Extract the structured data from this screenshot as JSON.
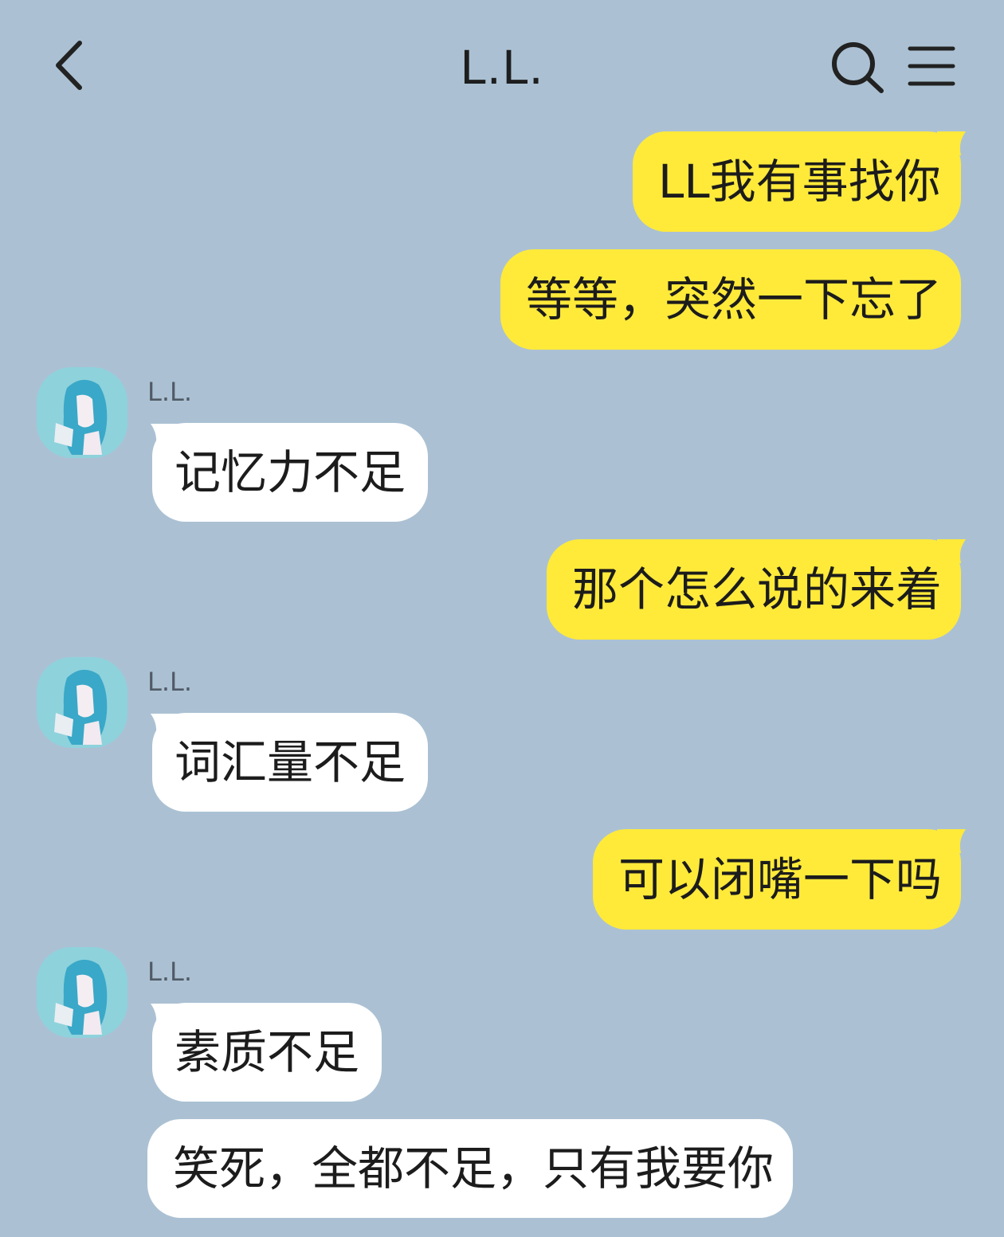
{
  "header": {
    "title": "L.L.",
    "back_icon": "chevron-left-icon",
    "search_icon": "search-icon",
    "menu_icon": "hamburger-menu-icon"
  },
  "colors": {
    "background": "#abc1d3",
    "my_bubble": "#ffea3a",
    "their_bubble": "#ffffff",
    "avatar_bg": "#8ed2dc"
  },
  "messages": [
    {
      "from": "me",
      "text": "LL我有事找你"
    },
    {
      "from": "me",
      "text": "等等，突然一下忘了"
    },
    {
      "from": "them",
      "sender": "L.L.",
      "text": "记忆力不足"
    },
    {
      "from": "me",
      "text": "那个怎么说的来着"
    },
    {
      "from": "them",
      "sender": "L.L.",
      "text": "词汇量不足"
    },
    {
      "from": "me",
      "text": "可以闭嘴一下吗"
    },
    {
      "from": "them",
      "sender": "L.L.",
      "text": "素质不足"
    },
    {
      "from": "them",
      "text": "笑死，全都不足，只有我要你"
    }
  ]
}
